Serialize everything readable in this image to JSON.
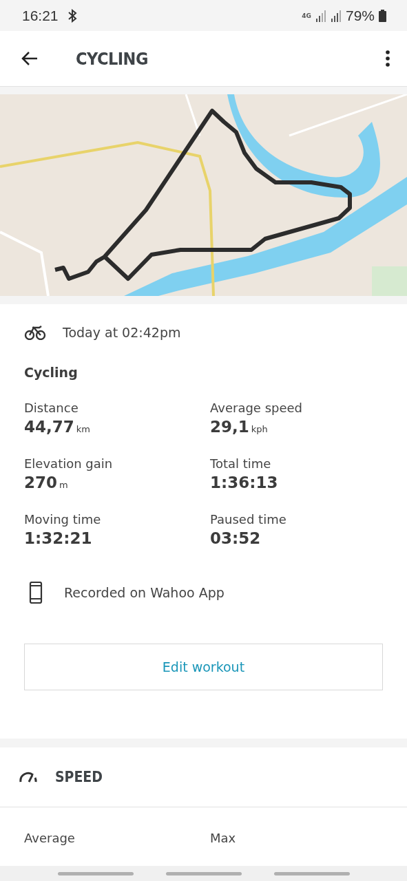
{
  "status_bar": {
    "time": "16:21",
    "network": "4G",
    "battery": "79%"
  },
  "header": {
    "title": "CYCLING"
  },
  "workout": {
    "date": "Today at 02:42pm",
    "name": "Cycling",
    "stats": [
      {
        "label": "Distance",
        "value": "44,77",
        "unit": "km"
      },
      {
        "label": "Average speed",
        "value": "29,1",
        "unit": "kph"
      },
      {
        "label": "Elevation gain",
        "value": "270",
        "unit": "m"
      },
      {
        "label": "Total time",
        "value": "1:36:13"
      },
      {
        "label": "Moving time",
        "value": "1:32:21"
      },
      {
        "label": "Paused time",
        "value": "03:52"
      }
    ],
    "recorded_on": "Recorded on Wahoo App",
    "edit_button": "Edit workout"
  },
  "speed_section": {
    "title": "SPEED",
    "columns": [
      "Average",
      "Max"
    ]
  }
}
